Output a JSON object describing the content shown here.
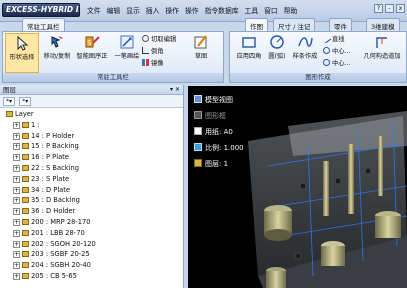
{
  "app": {
    "logo": "EXCESS-HYBRID II"
  },
  "menus": [
    "文件",
    "编辑",
    "显示",
    "插入",
    "操作",
    "操作",
    "指令数据库",
    "工具",
    "窗口",
    "帮助"
  ],
  "tabs_left": [
    "常驻工具栏"
  ],
  "tabs_right": [
    "作图",
    "尺寸 / 注记",
    "零件",
    "3维建模"
  ],
  "window_buttons": [
    "?",
    "-",
    "x"
  ],
  "ribbon_left": {
    "tools": [
      "形状选择",
      "移动/复制",
      "智能图序正",
      "一笔画绘",
      "草图"
    ],
    "small": [
      "切取编辑",
      "倒角",
      "镜像"
    ],
    "group_label": "常驻工具栏"
  },
  "ribbon_right": {
    "tools": [
      "应用四角",
      "圆(弧)",
      "样条作成",
      "几何构造道加"
    ],
    "small": [
      "直线",
      "中心...",
      "中心..."
    ],
    "group_label": "图形作成"
  },
  "layer_panel": {
    "title": "图层",
    "pin": "▾ ✕",
    "toolbar": [
      "*▾",
      "*▾"
    ],
    "root": "Layer",
    "items": [
      "1 :",
      "14 : P Holder",
      "15 : P Backing",
      "16 : P Plate",
      "22 : S Backing",
      "23 : S Plate",
      "34 : D Plate",
      "35 : D Backing",
      "36 : D Holder",
      "200 : MRP 28-170",
      "201 : LBB 28-70",
      "202 : SGOH 20-120",
      "203 : SGBF 20-25",
      "204 : SGBH 20-40",
      "205 : CB 5-65"
    ]
  },
  "viewport": {
    "info": [
      "模型视图",
      "图形框",
      "用纸: A0",
      "比例: 1.000",
      "图层: 1"
    ]
  }
}
